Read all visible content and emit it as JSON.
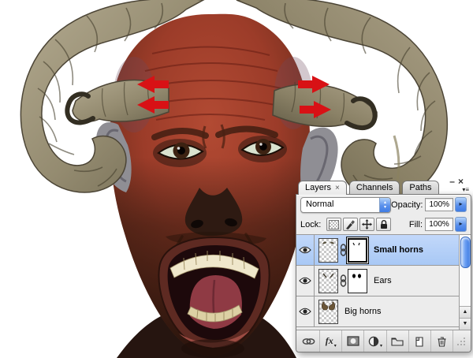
{
  "scene": {
    "background": "#ffffff",
    "artwork_alt": "Photomanipulated screaming demon head with large curled ram horns and small horns grafted onto the temples"
  },
  "annotations": {
    "arrow_color": "#d81115",
    "arrows": [
      "left-upper",
      "left-lower",
      "right-upper",
      "right-lower"
    ]
  },
  "panel": {
    "window_controls": {
      "minimize": "–",
      "close": "×"
    },
    "tabs": [
      {
        "label": "Layers",
        "close": "×",
        "active": true
      },
      {
        "label": "Channels",
        "active": false
      },
      {
        "label": "Paths",
        "active": false
      }
    ],
    "blend_mode_value": "Normal",
    "opacity_label": "Opacity:",
    "opacity_value": "100%",
    "lock_label": "Lock:",
    "lock_buttons": [
      "lock-transparent-pixels",
      "lock-image-pixels",
      "lock-position",
      "lock-all"
    ],
    "fill_label": "Fill:",
    "fill_value": "100%",
    "layers": [
      {
        "name": "Small horns",
        "selected": true,
        "visible": true,
        "has_mask": true,
        "linked": true
      },
      {
        "name": "Ears",
        "selected": false,
        "visible": true,
        "has_mask": true,
        "linked": true
      },
      {
        "name": "Big horns",
        "selected": false,
        "visible": true,
        "has_mask": false,
        "linked": false
      }
    ],
    "footer_fx_label": "fx",
    "footer_icons": [
      "link-layers",
      "layer-styles",
      "add-layer-mask",
      "adjustment-layer",
      "new-group",
      "new-layer",
      "delete-layer"
    ],
    "icons": {
      "stepper_up": "▴",
      "stepper_down": "▾",
      "value_arrow": "▸",
      "scroll_up": "▲",
      "scroll_down": "▼",
      "dropdown_caret": "▾",
      "panel_menu_caret": "▾",
      "panel_menu_lines": "≡"
    },
    "colors": {
      "selected_row": "#b3cff7",
      "panel_bg": "#ececec",
      "stepper_blue": "#5a90ec"
    }
  }
}
